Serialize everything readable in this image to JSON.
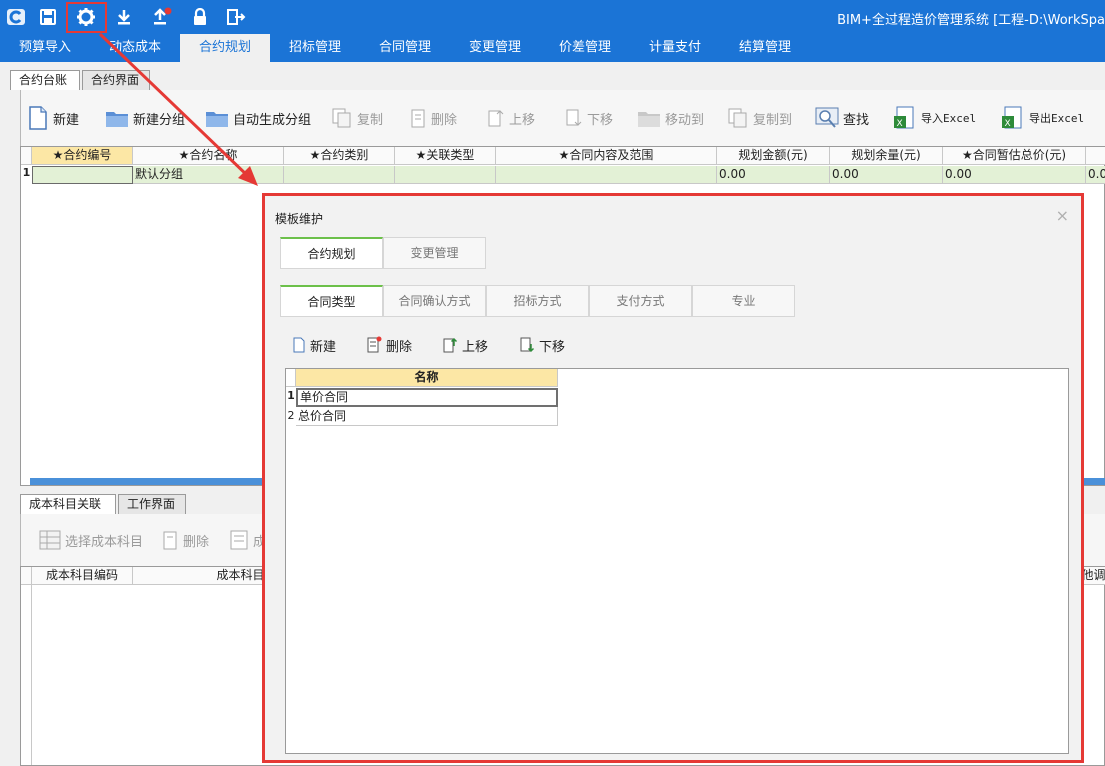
{
  "app": {
    "title": "BIM+全过程造价管理系统 [工程-D:\\WorkSpa"
  },
  "quick_access": [
    "app-logo-icon",
    "save-icon",
    "gear-icon",
    "download-icon",
    "upload-icon",
    "lock-icon",
    "exit-icon"
  ],
  "menu_tabs": [
    "预算导入",
    "动态成本",
    "合约规划",
    "招标管理",
    "合同管理",
    "变更管理",
    "价差管理",
    "计量支付",
    "结算管理"
  ],
  "sub_tabs": [
    "合约台账",
    "合约界面"
  ],
  "toolbar": {
    "new": "新建",
    "new_group": "新建分组",
    "auto_group": "自动生成分组",
    "copy": "复制",
    "delete": "删除",
    "move_up": "上移",
    "move_down": "下移",
    "move_to": "移动到",
    "copy_to": "复制到",
    "find": "查找",
    "import_excel": "导入Excel",
    "export_excel": "导出Excel"
  },
  "grid": {
    "headers": [
      "★合约编号",
      "★合约名称",
      "★合约类别",
      "★关联类型",
      "★合同内容及范围",
      "规划金额(元)",
      "规划余量(元)",
      "★合同暂估总价(元)"
    ],
    "rows": [
      {
        "num": "1",
        "name": "默认分组",
        "amount": "0.00",
        "remaining": "0.00",
        "estimate": "0.00",
        "extra": "0.0"
      }
    ]
  },
  "lower": {
    "tabs": [
      "成本科目关联",
      "工作界面"
    ],
    "toolbar": {
      "select_cost": "选择成本科目",
      "delete": "删除",
      "partial": "成"
    },
    "headers": [
      "成本科目编码",
      "成本科目名称",
      "他调"
    ]
  },
  "dialog": {
    "title": "模板维护",
    "close": "×",
    "top_tabs": [
      "合约规划",
      "变更管理"
    ],
    "sub_tabs": [
      "合同类型",
      "合同确认方式",
      "招标方式",
      "支付方式",
      "专业"
    ],
    "toolbar": {
      "new": "新建",
      "delete": "删除",
      "move_up": "上移",
      "move_down": "下移"
    },
    "grid_header": "名称",
    "rows": [
      {
        "num": "1",
        "name": "单价合同"
      },
      {
        "num": "2",
        "name": "总价合同"
      }
    ]
  }
}
